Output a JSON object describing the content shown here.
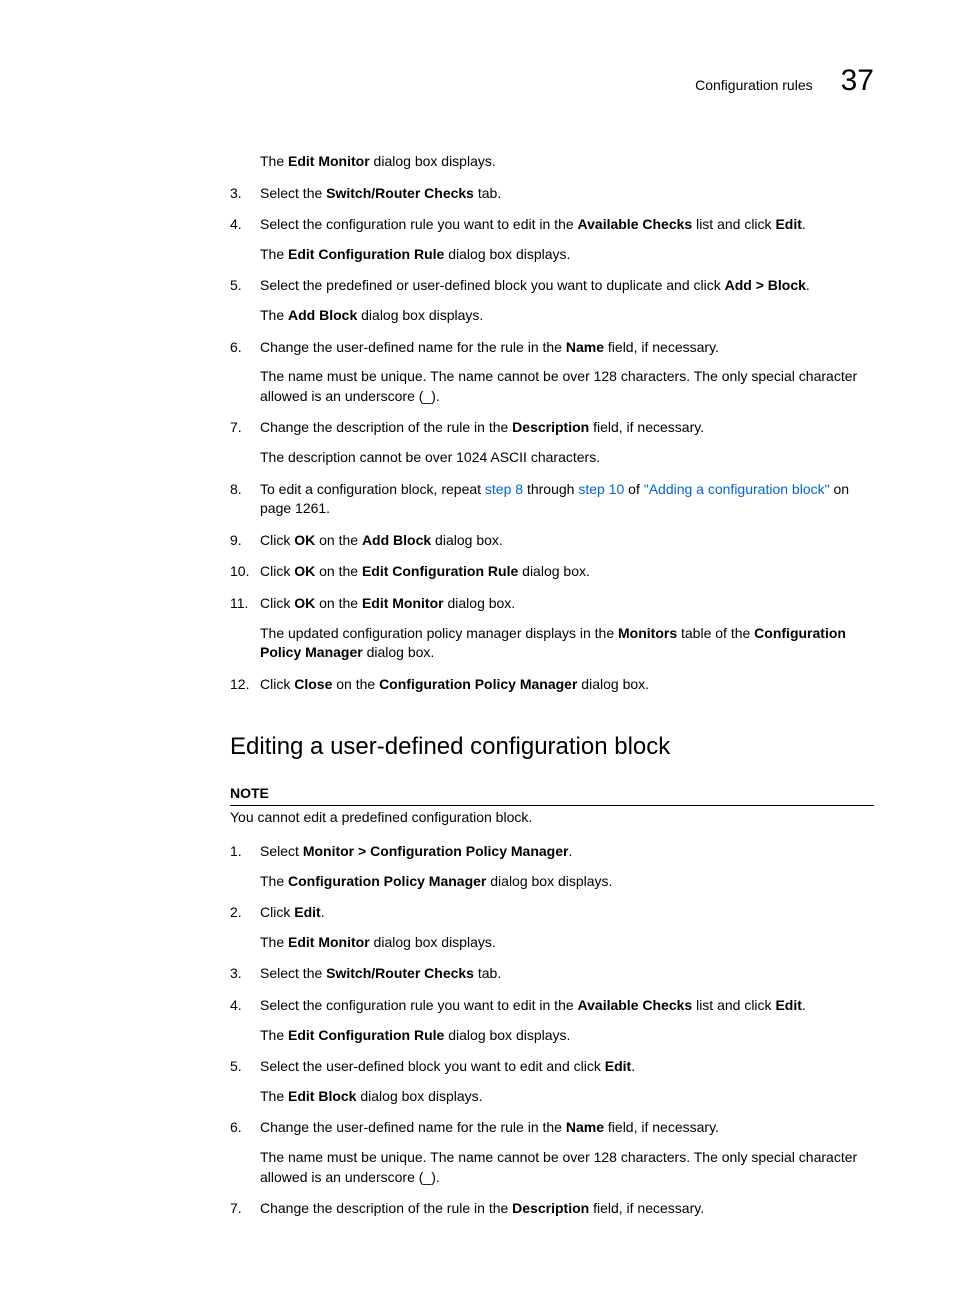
{
  "header": {
    "title": "Configuration rules",
    "chapter": "37"
  },
  "intro": {
    "pre": "The ",
    "bold": "Edit Monitor",
    "post": " dialog box displays."
  },
  "steps1": [
    {
      "n": "3.",
      "runs": [
        {
          "t": "Select the "
        },
        {
          "t": "Switch/Router Checks",
          "b": true
        },
        {
          "t": " tab."
        }
      ]
    },
    {
      "n": "4.",
      "runs": [
        {
          "t": "Select the configuration rule you want to edit in the "
        },
        {
          "t": "Available Checks",
          "b": true
        },
        {
          "t": " list and click "
        },
        {
          "t": "Edit",
          "b": true
        },
        {
          "t": "."
        }
      ],
      "sub": [
        {
          "t": "The "
        },
        {
          "t": "Edit Configuration Rule",
          "b": true
        },
        {
          "t": " dialog box displays."
        }
      ]
    },
    {
      "n": "5.",
      "runs": [
        {
          "t": "Select the predefined or user-defined block you want to duplicate and click "
        },
        {
          "t": "Add > Block",
          "b": true
        },
        {
          "t": "."
        }
      ],
      "sub": [
        {
          "t": "The "
        },
        {
          "t": "Add Block",
          "b": true
        },
        {
          "t": " dialog box displays."
        }
      ]
    },
    {
      "n": "6.",
      "runs": [
        {
          "t": "Change the user-defined name for the rule in the "
        },
        {
          "t": "Name",
          "b": true
        },
        {
          "t": " field, if necessary."
        }
      ],
      "sub": [
        {
          "t": "The name must be unique. The name cannot be over 128 characters. The only special character allowed is an underscore (_)."
        }
      ]
    },
    {
      "n": "7.",
      "runs": [
        {
          "t": "Change the description of the rule in the "
        },
        {
          "t": "Description",
          "b": true
        },
        {
          "t": " field, if necessary."
        }
      ],
      "sub": [
        {
          "t": "The description cannot be over 1024 ASCII characters."
        }
      ]
    },
    {
      "n": "8.",
      "runs": [
        {
          "t": "To edit a configuration block, repeat "
        },
        {
          "t": "step 8",
          "link": true
        },
        {
          "t": " through "
        },
        {
          "t": "step 10",
          "link": true
        },
        {
          "t": " of "
        },
        {
          "t": "\"Adding a configuration block\"",
          "link": true
        },
        {
          "t": " on page 1261."
        }
      ]
    },
    {
      "n": "9.",
      "runs": [
        {
          "t": "Click "
        },
        {
          "t": "OK",
          "b": true
        },
        {
          "t": " on the "
        },
        {
          "t": "Add Block",
          "b": true
        },
        {
          "t": " dialog box."
        }
      ]
    },
    {
      "n": "10.",
      "runs": [
        {
          "t": "Click "
        },
        {
          "t": "OK",
          "b": true
        },
        {
          "t": " on the "
        },
        {
          "t": "Edit Configuration Rule",
          "b": true
        },
        {
          "t": " dialog box."
        }
      ]
    },
    {
      "n": "11.",
      "runs": [
        {
          "t": "Click "
        },
        {
          "t": "OK",
          "b": true
        },
        {
          "t": " on the "
        },
        {
          "t": "Edit Monitor",
          "b": true
        },
        {
          "t": " dialog box."
        }
      ],
      "sub": [
        {
          "t": "The updated configuration policy manager displays in the "
        },
        {
          "t": "Monitors",
          "b": true
        },
        {
          "t": " table of the "
        },
        {
          "t": "Configuration Policy Manager",
          "b": true
        },
        {
          "t": " dialog box."
        }
      ]
    },
    {
      "n": "12.",
      "runs": [
        {
          "t": "Click "
        },
        {
          "t": "Close",
          "b": true
        },
        {
          "t": " on the "
        },
        {
          "t": "Configuration Policy Manager",
          "b": true
        },
        {
          "t": " dialog box."
        }
      ]
    }
  ],
  "section_heading": "Editing a user-defined configuration block",
  "note": {
    "label": "NOTE",
    "text": "You cannot edit a predefined configuration block."
  },
  "steps2": [
    {
      "n": "1.",
      "runs": [
        {
          "t": "Select "
        },
        {
          "t": "Monitor > Configuration Policy Manager",
          "b": true
        },
        {
          "t": "."
        }
      ],
      "sub": [
        {
          "t": "The "
        },
        {
          "t": "Configuration Policy Manager",
          "b": true
        },
        {
          "t": " dialog box displays."
        }
      ]
    },
    {
      "n": "2.",
      "runs": [
        {
          "t": "Click "
        },
        {
          "t": "Edit",
          "b": true
        },
        {
          "t": "."
        }
      ],
      "sub": [
        {
          "t": "The "
        },
        {
          "t": "Edit Monitor",
          "b": true
        },
        {
          "t": " dialog box displays."
        }
      ]
    },
    {
      "n": "3.",
      "runs": [
        {
          "t": "Select the "
        },
        {
          "t": "Switch/Router Checks",
          "b": true
        },
        {
          "t": " tab."
        }
      ]
    },
    {
      "n": "4.",
      "runs": [
        {
          "t": "Select the configuration rule you want to edit in the "
        },
        {
          "t": "Available Checks",
          "b": true
        },
        {
          "t": " list and click "
        },
        {
          "t": "Edit",
          "b": true
        },
        {
          "t": "."
        }
      ],
      "sub": [
        {
          "t": "The "
        },
        {
          "t": "Edit Configuration Rule",
          "b": true
        },
        {
          "t": " dialog box displays."
        }
      ]
    },
    {
      "n": "5.",
      "runs": [
        {
          "t": "Select the user-defined block you want to edit and click "
        },
        {
          "t": "Edit",
          "b": true
        },
        {
          "t": "."
        }
      ],
      "sub": [
        {
          "t": "The "
        },
        {
          "t": "Edit Block",
          "b": true
        },
        {
          "t": " dialog box displays."
        }
      ]
    },
    {
      "n": "6.",
      "runs": [
        {
          "t": "Change the user-defined name for the rule in the "
        },
        {
          "t": "Name",
          "b": true
        },
        {
          "t": " field, if necessary."
        }
      ],
      "sub": [
        {
          "t": "The name must be unique. The name cannot be over 128 characters. The only special character allowed is an underscore (_)."
        }
      ]
    },
    {
      "n": "7.",
      "runs": [
        {
          "t": "Change the description of the rule in the "
        },
        {
          "t": "Description",
          "b": true
        },
        {
          "t": " field, if necessary."
        }
      ]
    }
  ]
}
